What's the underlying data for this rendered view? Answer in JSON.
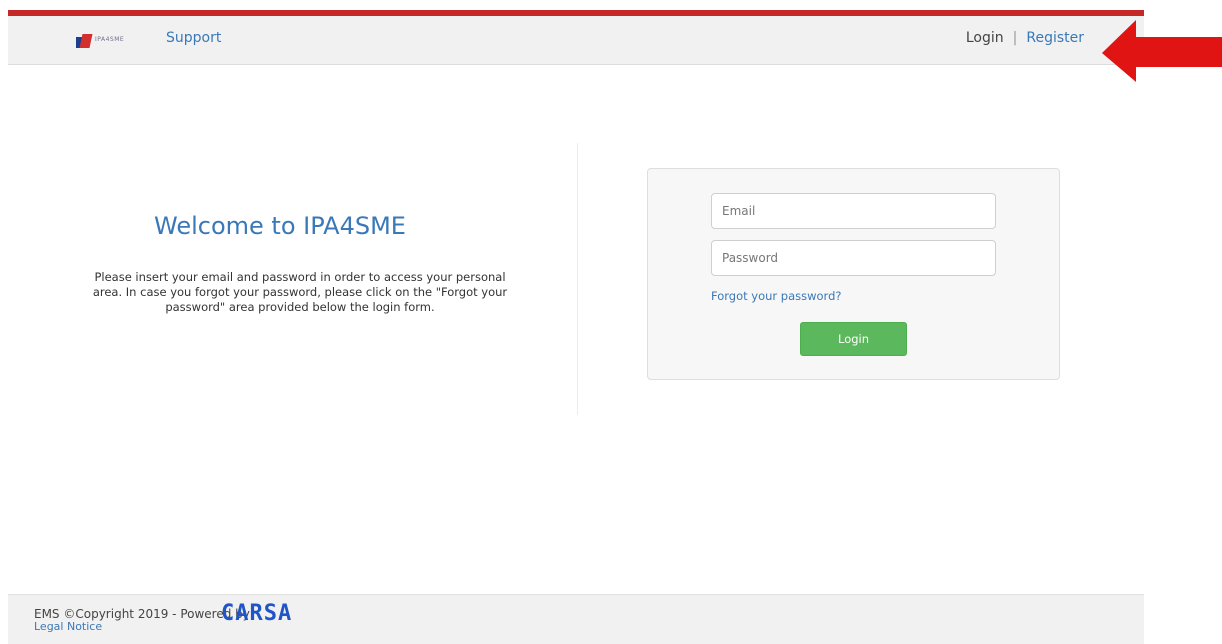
{
  "header": {
    "logo_text": "IPA4SME",
    "support_link": "Support",
    "login_link": "Login",
    "separator": "|",
    "register_link": "Register"
  },
  "welcome": {
    "title": "Welcome to IPA4SME",
    "description": "Please insert your email and password in order to access your personal area. In case you forgot your password, please click on the \"Forgot your password\" area provided below the login form."
  },
  "login_form": {
    "email_placeholder": "Email",
    "password_placeholder": "Password",
    "forgot_password_link": "Forgot your password?",
    "login_button": "Login"
  },
  "footer": {
    "copyright": "EMS ©Copyright 2019 - Powered by",
    "brand": "CARSA",
    "legal_notice": "Legal Notice"
  },
  "colors": {
    "accent_red": "#c62828",
    "link_blue": "#3a78b8",
    "button_green": "#5cb85c",
    "arrow_red": "#e11414"
  }
}
